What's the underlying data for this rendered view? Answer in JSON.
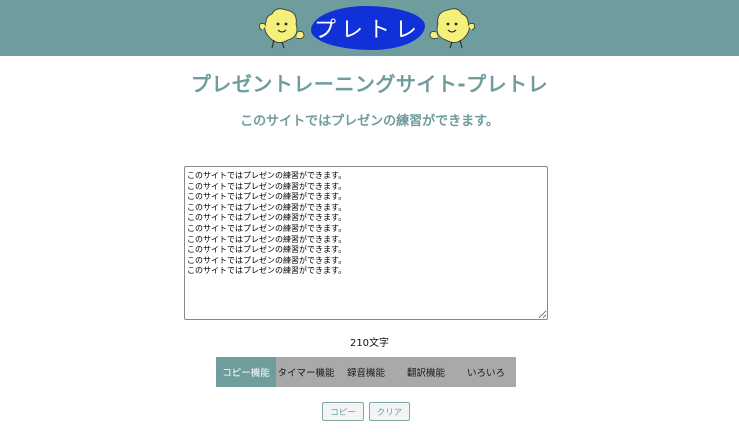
{
  "header": {
    "logo_text": "プレトレ",
    "colors": {
      "bar": "#6f9c9c",
      "logo": "#1030d8",
      "mascot": "#f5f07a"
    }
  },
  "main": {
    "title": "プレゼントレーニングサイト-プレトレ",
    "subtitle": "このサイトではプレゼンの練習ができます。",
    "editor_text": "このサイトではプレゼンの練習ができます。\nこのサイトではプレゼンの練習ができます。\nこのサイトではプレゼンの練習ができます。\nこのサイトではプレゼンの練習ができます。\nこのサイトではプレゼンの練習ができます。\nこのサイトではプレゼンの練習ができます。\nこのサイトではプレゼンの練習ができます。\nこのサイトではプレゼンの練習ができます。\nこのサイトではプレゼンの練習ができます。\nこのサイトではプレゼンの練習ができます。",
    "char_count": "210文字"
  },
  "tabs": [
    {
      "label": "コピー機能",
      "active": true
    },
    {
      "label": "タイマー機能",
      "active": false
    },
    {
      "label": "録音機能",
      "active": false
    },
    {
      "label": "翻訳機能",
      "active": false
    },
    {
      "label": "いろいろ",
      "active": false
    }
  ],
  "actions": {
    "copy_label": "コピー",
    "clear_label": "クリア"
  }
}
